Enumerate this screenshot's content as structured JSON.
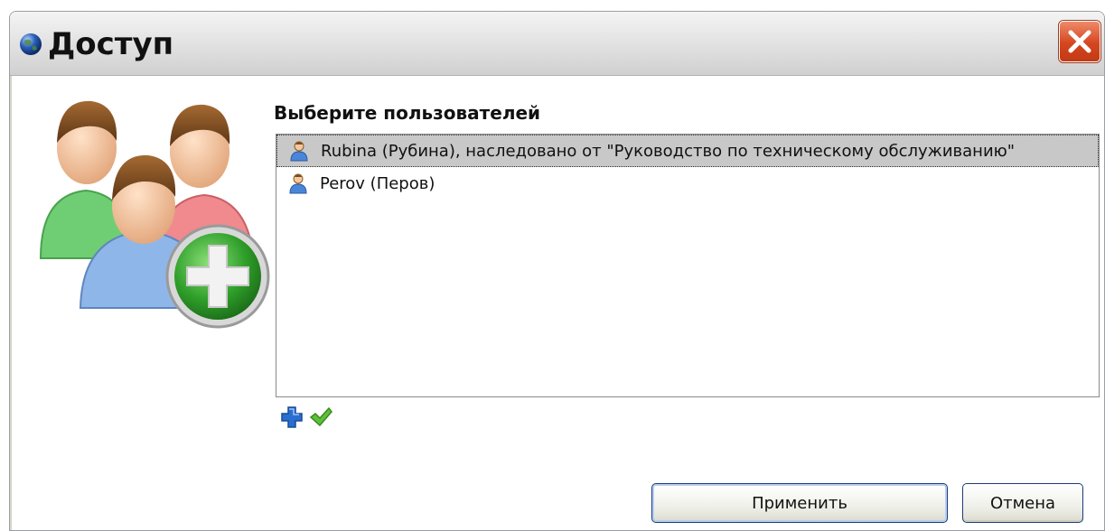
{
  "window": {
    "title": "Доступ"
  },
  "section_label": "Выберите пользователей",
  "users": [
    {
      "label": "Rubina (Рубина), наследовано от \"Руководство по техническому обслуживанию\"",
      "selected": true
    },
    {
      "label": "Perov (Перов)",
      "selected": false
    }
  ],
  "icons": {
    "title": "globe-icon",
    "close": "close-icon",
    "illustration": "users-add-icon",
    "user": "user-icon",
    "add": "plus-icon",
    "confirm": "checkmark-icon"
  },
  "buttons": {
    "apply": "Применить",
    "cancel": "Отмена"
  },
  "colors": {
    "selection": "#c8c8c8",
    "close_button": "#d4461f",
    "add_icon": "#2a6fd0",
    "check_icon": "#5fbf3a"
  }
}
